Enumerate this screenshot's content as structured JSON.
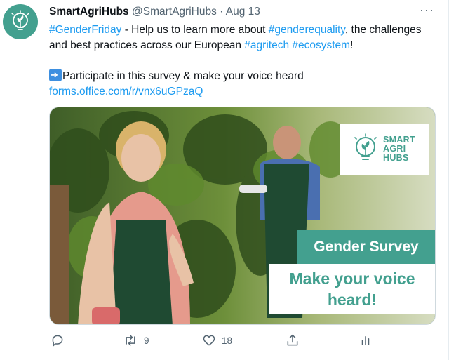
{
  "tweet": {
    "display_name": "SmartAgriHubs",
    "handle": "@SmartAgriHubs",
    "separator": "·",
    "date": "Aug 13",
    "more_label": "···",
    "text": {
      "hashtag_gender_friday": "#GenderFriday",
      "part1": " - Help us to learn more about ",
      "hashtag_gender_equality": "#genderequality",
      "part2": ", the challenges and best practices across our European ",
      "hashtag_agritech": "#agritech",
      "space": " ",
      "hashtag_ecosystem": "#ecosystem",
      "part3": "!",
      "participate": "Participate in this survey & make your voice heard",
      "link": "forms.office.com/r/vnx6uGPzaQ"
    },
    "media": {
      "logo_line1": "SMART",
      "logo_line2": "AGRI",
      "logo_line3": "HUBS",
      "banner_title": "Gender Survey",
      "banner_line1": "Make your voice",
      "banner_line2": "heard!"
    },
    "actions": {
      "reply_icon": "reply-icon",
      "retweet_icon": "retweet-icon",
      "retweet_count": "9",
      "like_icon": "heart-icon",
      "like_count": "18",
      "share_icon": "share-icon",
      "analytics_icon": "analytics-icon"
    },
    "colors": {
      "brand_teal": "#43a08f",
      "link_blue": "#1d9bf0",
      "muted": "#536471"
    }
  }
}
